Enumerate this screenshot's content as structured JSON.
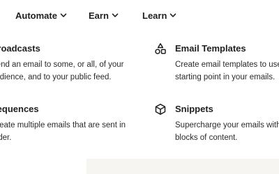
{
  "nav": {
    "items": [
      {
        "label": "Automate",
        "icon": "chevron-down-icon"
      },
      {
        "label": "Earn",
        "icon": "chevron-down-icon"
      },
      {
        "label": "Learn",
        "icon": "chevron-down-icon"
      }
    ]
  },
  "features": {
    "broadcasts": {
      "title": "Broadcasts",
      "desc_lines": [
        "Send an email to some, or all, of your",
        "audience, and to your public feed."
      ]
    },
    "sequences": {
      "title": "Sequences",
      "desc_lines": [
        "Create multiple emails that are sent in",
        "order."
      ]
    },
    "templates": {
      "title": "Email Templates",
      "icon": "shapes-icon",
      "desc_lines": [
        "Create email templates to use as a",
        "starting point in your emails."
      ]
    },
    "snippets": {
      "title": "Snippets",
      "icon": "cube-icon",
      "desc_lines": [
        "Supercharge your emails with reusable",
        "blocks of content."
      ]
    }
  },
  "colors": {
    "text": "#1f1f1f",
    "muted_bg": "#f7f5f2"
  }
}
